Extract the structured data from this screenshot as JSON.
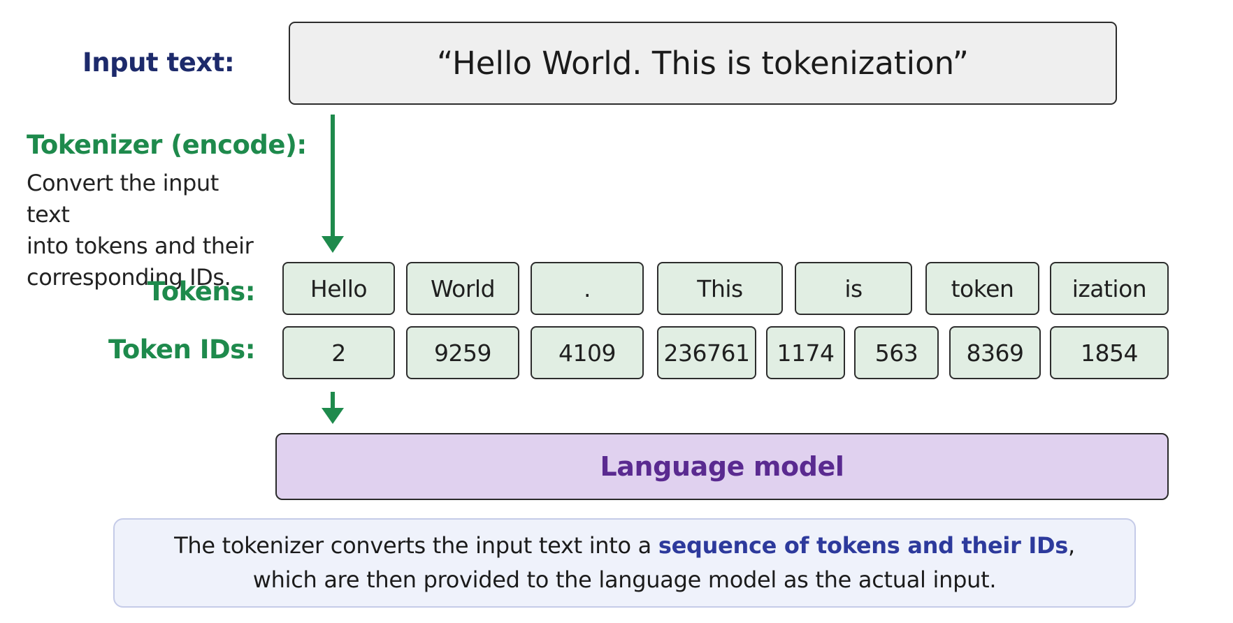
{
  "input": {
    "label": "Input text:",
    "text": "“Hello World. This is tokenization”"
  },
  "tokenizer": {
    "title": "Tokenizer (encode):",
    "description_lines": [
      "Convert the input text",
      "into tokens and their",
      "corresponding IDs."
    ]
  },
  "tokens_row": {
    "label": "Tokens:",
    "items": [
      "Hello",
      "World",
      ".",
      "This",
      "is",
      "token",
      "ization"
    ]
  },
  "ids_row": {
    "label": "Token IDs:",
    "items": [
      "2",
      "9259",
      "4109",
      "236761",
      "1174",
      "563",
      "8369",
      "1854"
    ]
  },
  "model": {
    "label": "Language model"
  },
  "note": {
    "line1_before": "The tokenizer converts the input text into a ",
    "line1_highlight": "sequence of tokens and their IDs",
    "line1_after": ",",
    "line2": "which are then provided to the language model as the actual input."
  },
  "colors": {
    "navy": "#1d2a6b",
    "green": "#1e8a4c",
    "token_fill": "#e1eee3",
    "model_fill": "#e0d1ef",
    "model_text": "#5a2a90",
    "highlight": "#2d3a9c"
  }
}
